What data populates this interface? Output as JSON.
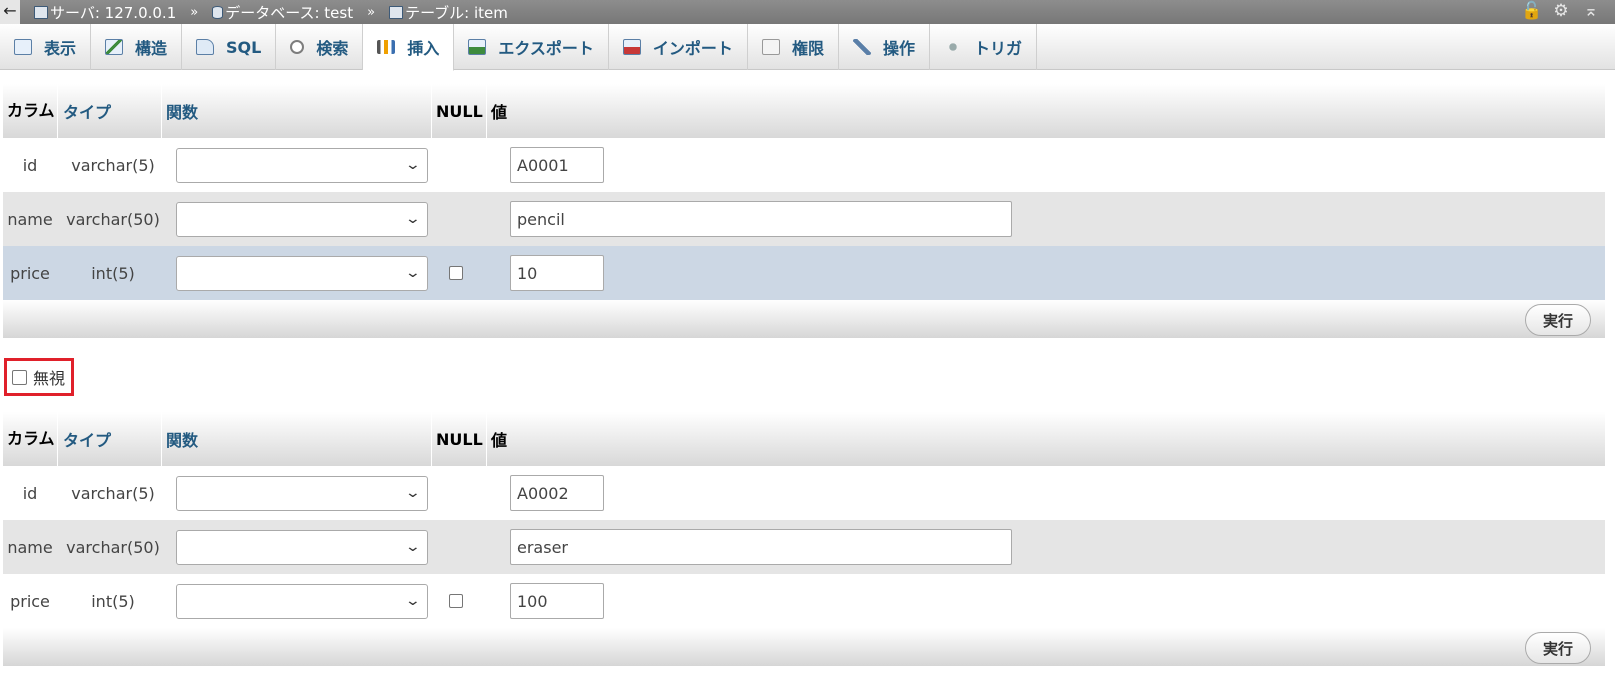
{
  "breadcrumb": {
    "back": "←",
    "server": "サーバ: 127.0.0.1",
    "database": "データベース: test",
    "table": "テーブル: item",
    "separator": "»"
  },
  "tabs": [
    {
      "label": "表示",
      "icon": "browse-icon"
    },
    {
      "label": "構造",
      "icon": "structure-icon"
    },
    {
      "label": "SQL",
      "icon": "sql-icon"
    },
    {
      "label": "検索",
      "icon": "search-icon"
    },
    {
      "label": "挿入",
      "icon": "insert-icon",
      "active": true
    },
    {
      "label": "エクスポート",
      "icon": "export-icon"
    },
    {
      "label": "インポート",
      "icon": "import-icon"
    },
    {
      "label": "権限",
      "icon": "privileges-icon"
    },
    {
      "label": "操作",
      "icon": "operations-icon"
    },
    {
      "label": "トリガ",
      "icon": "triggers-icon"
    }
  ],
  "header": {
    "column": "カラム",
    "type": "タイプ",
    "function": "関数",
    "null": "NULL",
    "value": "値"
  },
  "form1": {
    "rows": [
      {
        "column": "id",
        "type": "varchar(5)",
        "value": "A0001"
      },
      {
        "column": "name",
        "type": "varchar(50)",
        "value": "pencil"
      },
      {
        "column": "price",
        "type": "int(5)",
        "value": "10"
      }
    ],
    "go_label": "実行"
  },
  "ignore_label": "無視",
  "form2": {
    "rows": [
      {
        "column": "id",
        "type": "varchar(5)",
        "value": "A0002"
      },
      {
        "column": "name",
        "type": "varchar(50)",
        "value": "eraser"
      },
      {
        "column": "price",
        "type": "int(5)",
        "value": "100"
      }
    ],
    "go_label": "実行"
  },
  "colors": {
    "accent": "#235a81",
    "highlight_row": "#ccd7e4",
    "alt_row": "#e5e5e5",
    "ignore_border": "#e0202a"
  }
}
